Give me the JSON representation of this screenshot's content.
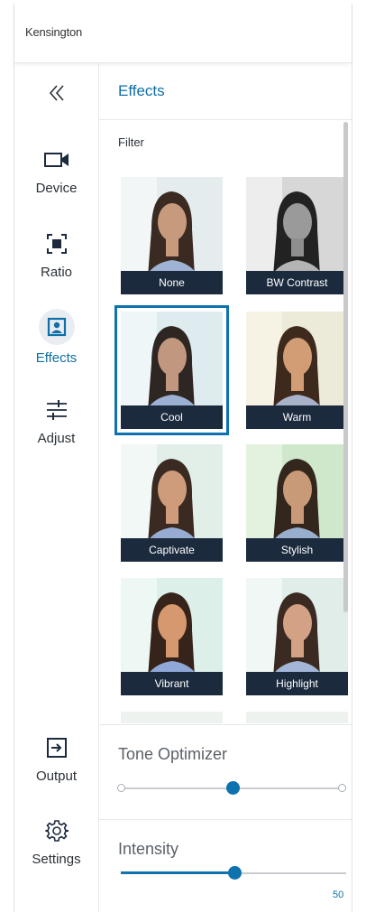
{
  "app": {
    "brand": "Kensington"
  },
  "sidebar": {
    "collapse_icon": "double-chevron-left-icon",
    "items": [
      {
        "label": "Device",
        "icon": "camera-icon"
      },
      {
        "label": "Ratio",
        "icon": "ratio-frame-icon"
      },
      {
        "label": "Effects",
        "icon": "portrait-icon",
        "active": true
      },
      {
        "label": "Adjust",
        "icon": "sliders-icon"
      },
      {
        "label": "Output",
        "icon": "output-arrow-icon"
      },
      {
        "label": "Settings",
        "icon": "gear-icon"
      }
    ]
  },
  "main": {
    "title": "Effects",
    "filter_title": "Filter",
    "filters": [
      {
        "label": "None"
      },
      {
        "label": "BW Contrast"
      },
      {
        "label": "Cool",
        "selected": true
      },
      {
        "label": "Warm"
      },
      {
        "label": "Captivate"
      },
      {
        "label": "Stylish"
      },
      {
        "label": "Vibrant"
      },
      {
        "label": "Highlight"
      }
    ],
    "tone_optimizer": {
      "label": "Tone Optimizer",
      "value_fraction": 0.5
    },
    "intensity": {
      "label": "Intensity",
      "value": "50",
      "value_fraction": 0.5
    }
  },
  "colors": {
    "accent": "#0d72ad",
    "label_bg": "#1c2a3e"
  }
}
